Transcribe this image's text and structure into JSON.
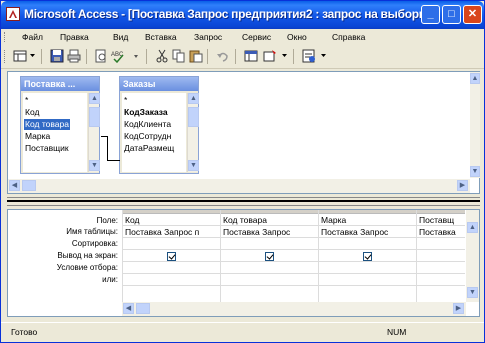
{
  "window": {
    "title": "Microsoft Access - [Поставка Запрос предприятия2 : запрос на выборку]",
    "minimize_symbol": "_",
    "maximize_symbol": "□",
    "close_symbol": "✕"
  },
  "menu": [
    "Файл",
    "Правка",
    "Вид",
    "Вставка",
    "Запрос",
    "Сервис",
    "Окно",
    "Справка"
  ],
  "toolbar": {
    "icons": [
      "view-icon",
      "save-icon",
      "print-icon",
      "print-preview-icon",
      "spelling-icon",
      "cut-icon",
      "copy-icon",
      "paste-icon",
      "undo-icon",
      "query-type-icon",
      "run-icon",
      "show-table-icon",
      "totals-icon",
      "top-values-icon",
      "properties-icon",
      "build-icon"
    ]
  },
  "tables": [
    {
      "title": "Поставка ...",
      "fields": [
        {
          "name": "*",
          "bold": false,
          "selected": false
        },
        {
          "name": "Код",
          "bold": false,
          "selected": false
        },
        {
          "name": "Код товара",
          "bold": false,
          "selected": true
        },
        {
          "name": "Марка",
          "bold": false,
          "selected": false
        },
        {
          "name": "Поставщик",
          "bold": false,
          "selected": false
        }
      ]
    },
    {
      "title": "Заказы",
      "fields": [
        {
          "name": "*",
          "bold": false,
          "selected": false
        },
        {
          "name": "КодЗаказа",
          "bold": true,
          "selected": false
        },
        {
          "name": "КодКлиента",
          "bold": false,
          "selected": false
        },
        {
          "name": "КодСотрудн",
          "bold": false,
          "selected": false
        },
        {
          "name": "ДатаРазмещ",
          "bold": false,
          "selected": false
        }
      ]
    }
  ],
  "grid": {
    "row_labels": [
      "Поле:",
      "Имя таблицы:",
      "Сортировка:",
      "Вывод на экран:",
      "Условие отбора:",
      "или:"
    ],
    "columns": [
      {
        "field": "Код",
        "table": "Поставка Запрос п",
        "sort": "",
        "show": true
      },
      {
        "field": "Код товара",
        "table": "Поставка Запрос",
        "sort": "",
        "show": true
      },
      {
        "field": "Марка",
        "table": "Поставка Запрос",
        "sort": "",
        "show": true
      },
      {
        "field": "Поставщ",
        "table": "Поставка",
        "sort": "",
        "show": false
      }
    ]
  },
  "status": {
    "left": "Готово",
    "right": "NUM"
  },
  "colors": {
    "titlebar": "#0a46d6",
    "selection": "#316ac5",
    "close_button": "#d9461c"
  }
}
